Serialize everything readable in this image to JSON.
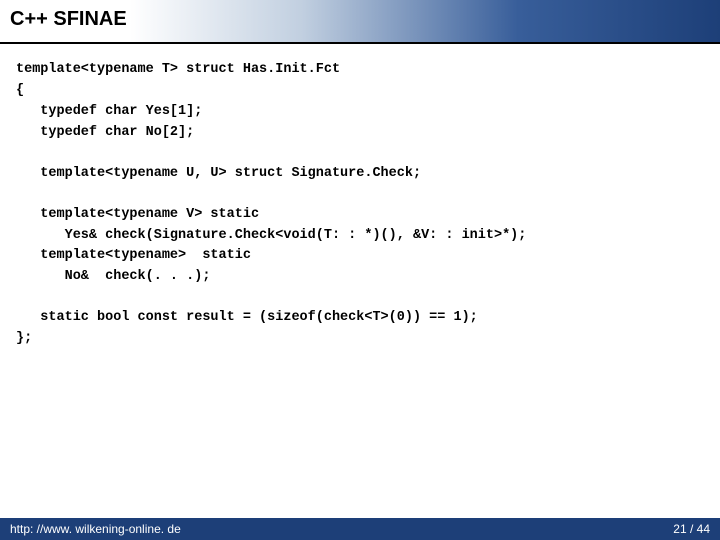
{
  "title": "C++ SFINAE",
  "code": {
    "lines": [
      "template<typename T> struct Has.Init.Fct",
      "{",
      "   typedef char Yes[1];",
      "   typedef char No[2];",
      "",
      "   template<typename U, U> struct Signature.Check;",
      "",
      "   template<typename V> static",
      "      Yes& check(Signature.Check<void(T: : *)(), &V: : init>*);",
      "   template<typename>  static",
      "      No&  check(. . .);",
      "",
      "   static bool const result = (sizeof(check<T>(0)) == 1);",
      "};"
    ]
  },
  "footer": {
    "url": "http: //www. wilkening-online. de",
    "page": "21 / 44"
  }
}
